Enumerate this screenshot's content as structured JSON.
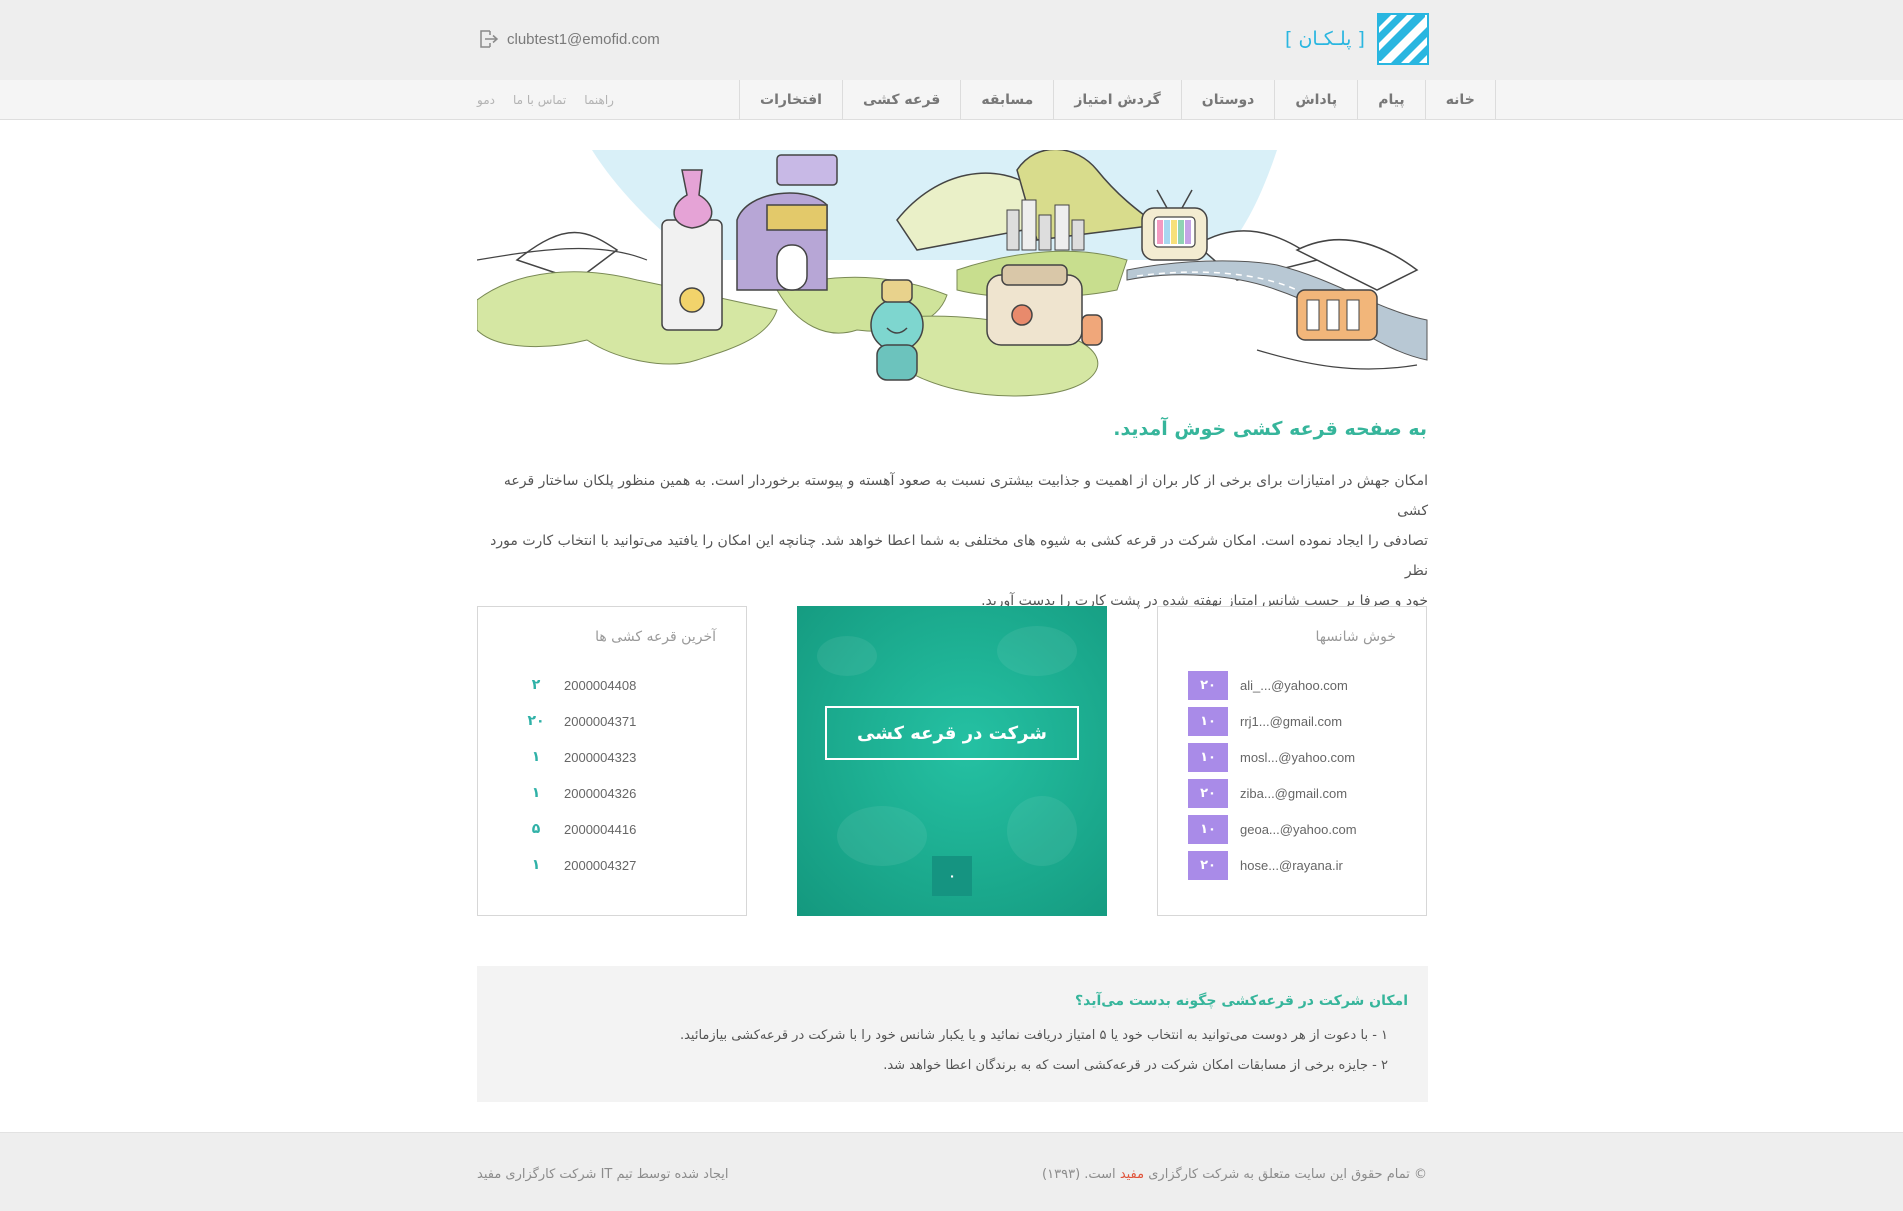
{
  "header": {
    "email": "clubtest1@emofid.com",
    "logo_text": "[ پلـکـان ]",
    "logout_icon": "logout-icon",
    "logo_icon": "stairs-logo-icon"
  },
  "nav": {
    "main": [
      "خانه",
      "پیام",
      "پاداش",
      "دوستان",
      "گردش امتیاز",
      "مسابقه",
      "قرعه کشی",
      "افتخارات"
    ],
    "secondary": [
      "راهنما",
      "تماس با ما",
      "دمو"
    ]
  },
  "welcome": {
    "title": "به صفحه قرعه کشی خوش آمدید.",
    "line1": "امکان جهش در امتیازات برای برخی از کار بران از اهمیت و جذابیت بیشتری نسبت به صعود آهسته و پیوسته برخوردار است. به همین منظور پلکان ساختار قرعه کشی",
    "line2": "تصادفی را ایجاد نموده است. امکان شرکت در قرعه کشی به شیوه های مختلفی به شما اعطا خواهد شد. چنانچه این امکان را یافتید می‌توانید با انتخاب کارت مورد نظر",
    "line3": "خود و صرفا بر حسب شانس امتیاز نهفته شده در پشت کارت را بدست آورید."
  },
  "winners": {
    "title": "خوش شانسها",
    "rows": [
      {
        "points": "۲۰",
        "email": "ali_...@yahoo.com"
      },
      {
        "points": "۱۰",
        "email": "rrj1...@gmail.com"
      },
      {
        "points": "۱۰",
        "email": "mosl...@yahoo.com"
      },
      {
        "points": "۲۰",
        "email": "ziba...@gmail.com"
      },
      {
        "points": "۱۰",
        "email": "geoa...@yahoo.com"
      },
      {
        "points": "۲۰",
        "email": "hose...@rayana.ir"
      }
    ]
  },
  "draw_card": {
    "button_label": "شرکت در قرعه کشی",
    "counter": "۰"
  },
  "latest": {
    "title": "آخرین قرعه کشی ها",
    "rows": [
      {
        "number": "۲",
        "id": "2000004408"
      },
      {
        "number": "۲۰",
        "id": "2000004371"
      },
      {
        "number": "۱",
        "id": "2000004323"
      },
      {
        "number": "۱",
        "id": "2000004326"
      },
      {
        "number": "۵",
        "id": "2000004416"
      },
      {
        "number": "۱",
        "id": "2000004327"
      }
    ]
  },
  "howto": {
    "title": "امکان شرکت در قرعه‌کشی چگونه بدست می‌آید؟",
    "line1": "۱ - با دعوت از هر دوست می‌توانید به انتخاب خود یا ۵ امتیاز دریافت نمائید و یا یکبار شانس خود را با شرکت در قرعه‌کشی بیازمائید.",
    "line2": "۲ - جایزه برخی از مسابقات امکان شرکت در قرعه‌کشی است که به برندگان اعطا خواهد شد."
  },
  "footer": {
    "copyright_prefix": "© تمام حقوق این سایت متعلق به شرکت کارگزاری",
    "copyright_brand": "مفید",
    "copyright_suffix": "است. (۱۳۹۳)",
    "credit": "ایجاد شده توسط تیم IT شرکت کارگزاری مفید"
  },
  "colors": {
    "accent_green": "#36b59b",
    "badge_purple": "#a98be8",
    "card_green": "#1daf92",
    "brand_red": "#e0533a",
    "logo_blue": "#29b6e0"
  }
}
